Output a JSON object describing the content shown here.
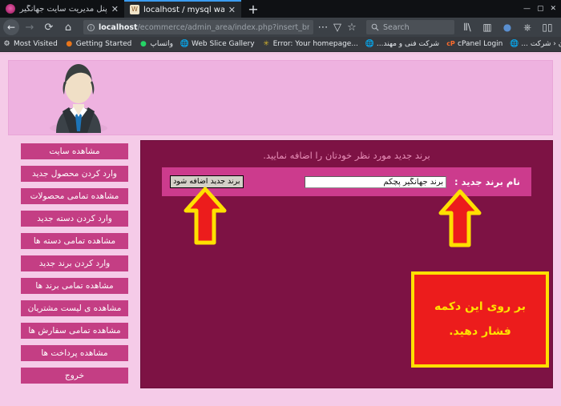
{
  "browser": {
    "tabs": [
      {
        "title": "پنل مدیریت سایت جهانگیر پچکم",
        "favicon": "pink-circle-icon",
        "active": false,
        "close_label": "✕"
      },
      {
        "title": "localhost / mysql wampserver / ec",
        "favicon": "wamp-icon",
        "active": true,
        "close_label": "✕"
      }
    ],
    "new_tab_label": "+",
    "window_controls": {
      "minimize": "—",
      "maximize": "▢",
      "close": "✕"
    },
    "nav": {
      "back_icon": "←",
      "forward_icon": "→",
      "reload_icon": "⟳",
      "home_icon": "⌂"
    },
    "url": {
      "info_icon": "ⓘ",
      "host": "localhost",
      "path": "/ecommerce/admin_area/index.php?insert_bra",
      "page_actions_icon": "⋯",
      "reader_icon": "▽",
      "bookmark_star_icon": "☆"
    },
    "search": {
      "icon": "search-icon",
      "placeholder": "Search"
    },
    "toolbar_icons": [
      "library-icon",
      "sidebar-icon",
      "account-icon",
      "pocket-icon",
      "bookshelf-icon"
    ],
    "bookmarks": [
      {
        "label": "Most Visited",
        "icon": "gear-icon"
      },
      {
        "label": "Getting Started",
        "icon": "firefox-icon"
      },
      {
        "label": "واتساپ",
        "icon": "whatsapp-icon",
        "rtl": true
      },
      {
        "label": "Web Slice Gallery",
        "icon": "globe-icon"
      },
      {
        "label": "Error: Your homepage...",
        "icon": "warning-icon"
      },
      {
        "label": "شرکت فنی و مهند...",
        "icon": "globe-icon",
        "rtl": true
      },
      {
        "label": "cPanel Login",
        "icon": "cpanel-icon"
      },
      {
        "label": "پیشخوان ‹ شرکت ...",
        "icon": "globe-icon",
        "rtl": true
      }
    ]
  },
  "page": {
    "banner": {
      "avatar_icon": "admin-avatar-icon"
    },
    "panel": {
      "title": "برند جدید مورد نظر خودتان را اضافه نمایید.",
      "label": "نام برند جدید :",
      "input_value": "برند جهانگیر پچکم",
      "input_placeholder": "",
      "submit_label": "برند جدید اضافه شود"
    },
    "annotations": {
      "callout_line1": "بر روی این دکمه",
      "callout_line2": "فشار دهید.",
      "arrow_button_name": "up-arrow-icon",
      "arrow_input_name": "up-arrow-icon"
    },
    "sidebar": [
      {
        "label": "مشاهده سایت"
      },
      {
        "label": "وارد کردن محصول جدید"
      },
      {
        "label": "مشاهده تمامی محصولات"
      },
      {
        "label": "وارد کردن دسته جدید"
      },
      {
        "label": "مشاهده تمامی دسته ها"
      },
      {
        "label": "وارد کردن برند جدید"
      },
      {
        "label": "مشاهده تمامی برند ها"
      },
      {
        "label": "مشاهده ی لیست مشتریان"
      },
      {
        "label": "مشاهده تمامی سفارش ها"
      },
      {
        "label": "مشاهده پرداخت ها"
      },
      {
        "label": "خروج"
      }
    ]
  },
  "colors": {
    "panel_bg": "#7d1244",
    "band_bg": "#cc3b8d",
    "sidebar_btn": "#c43e84",
    "page_bg": "#f5cbe8",
    "banner_bg": "#eeb2e0",
    "callout_bg": "#ec1c1c",
    "callout_border": "#ffe000",
    "arrow_fill": "#ec1c1c",
    "arrow_stroke": "#ffe000"
  }
}
